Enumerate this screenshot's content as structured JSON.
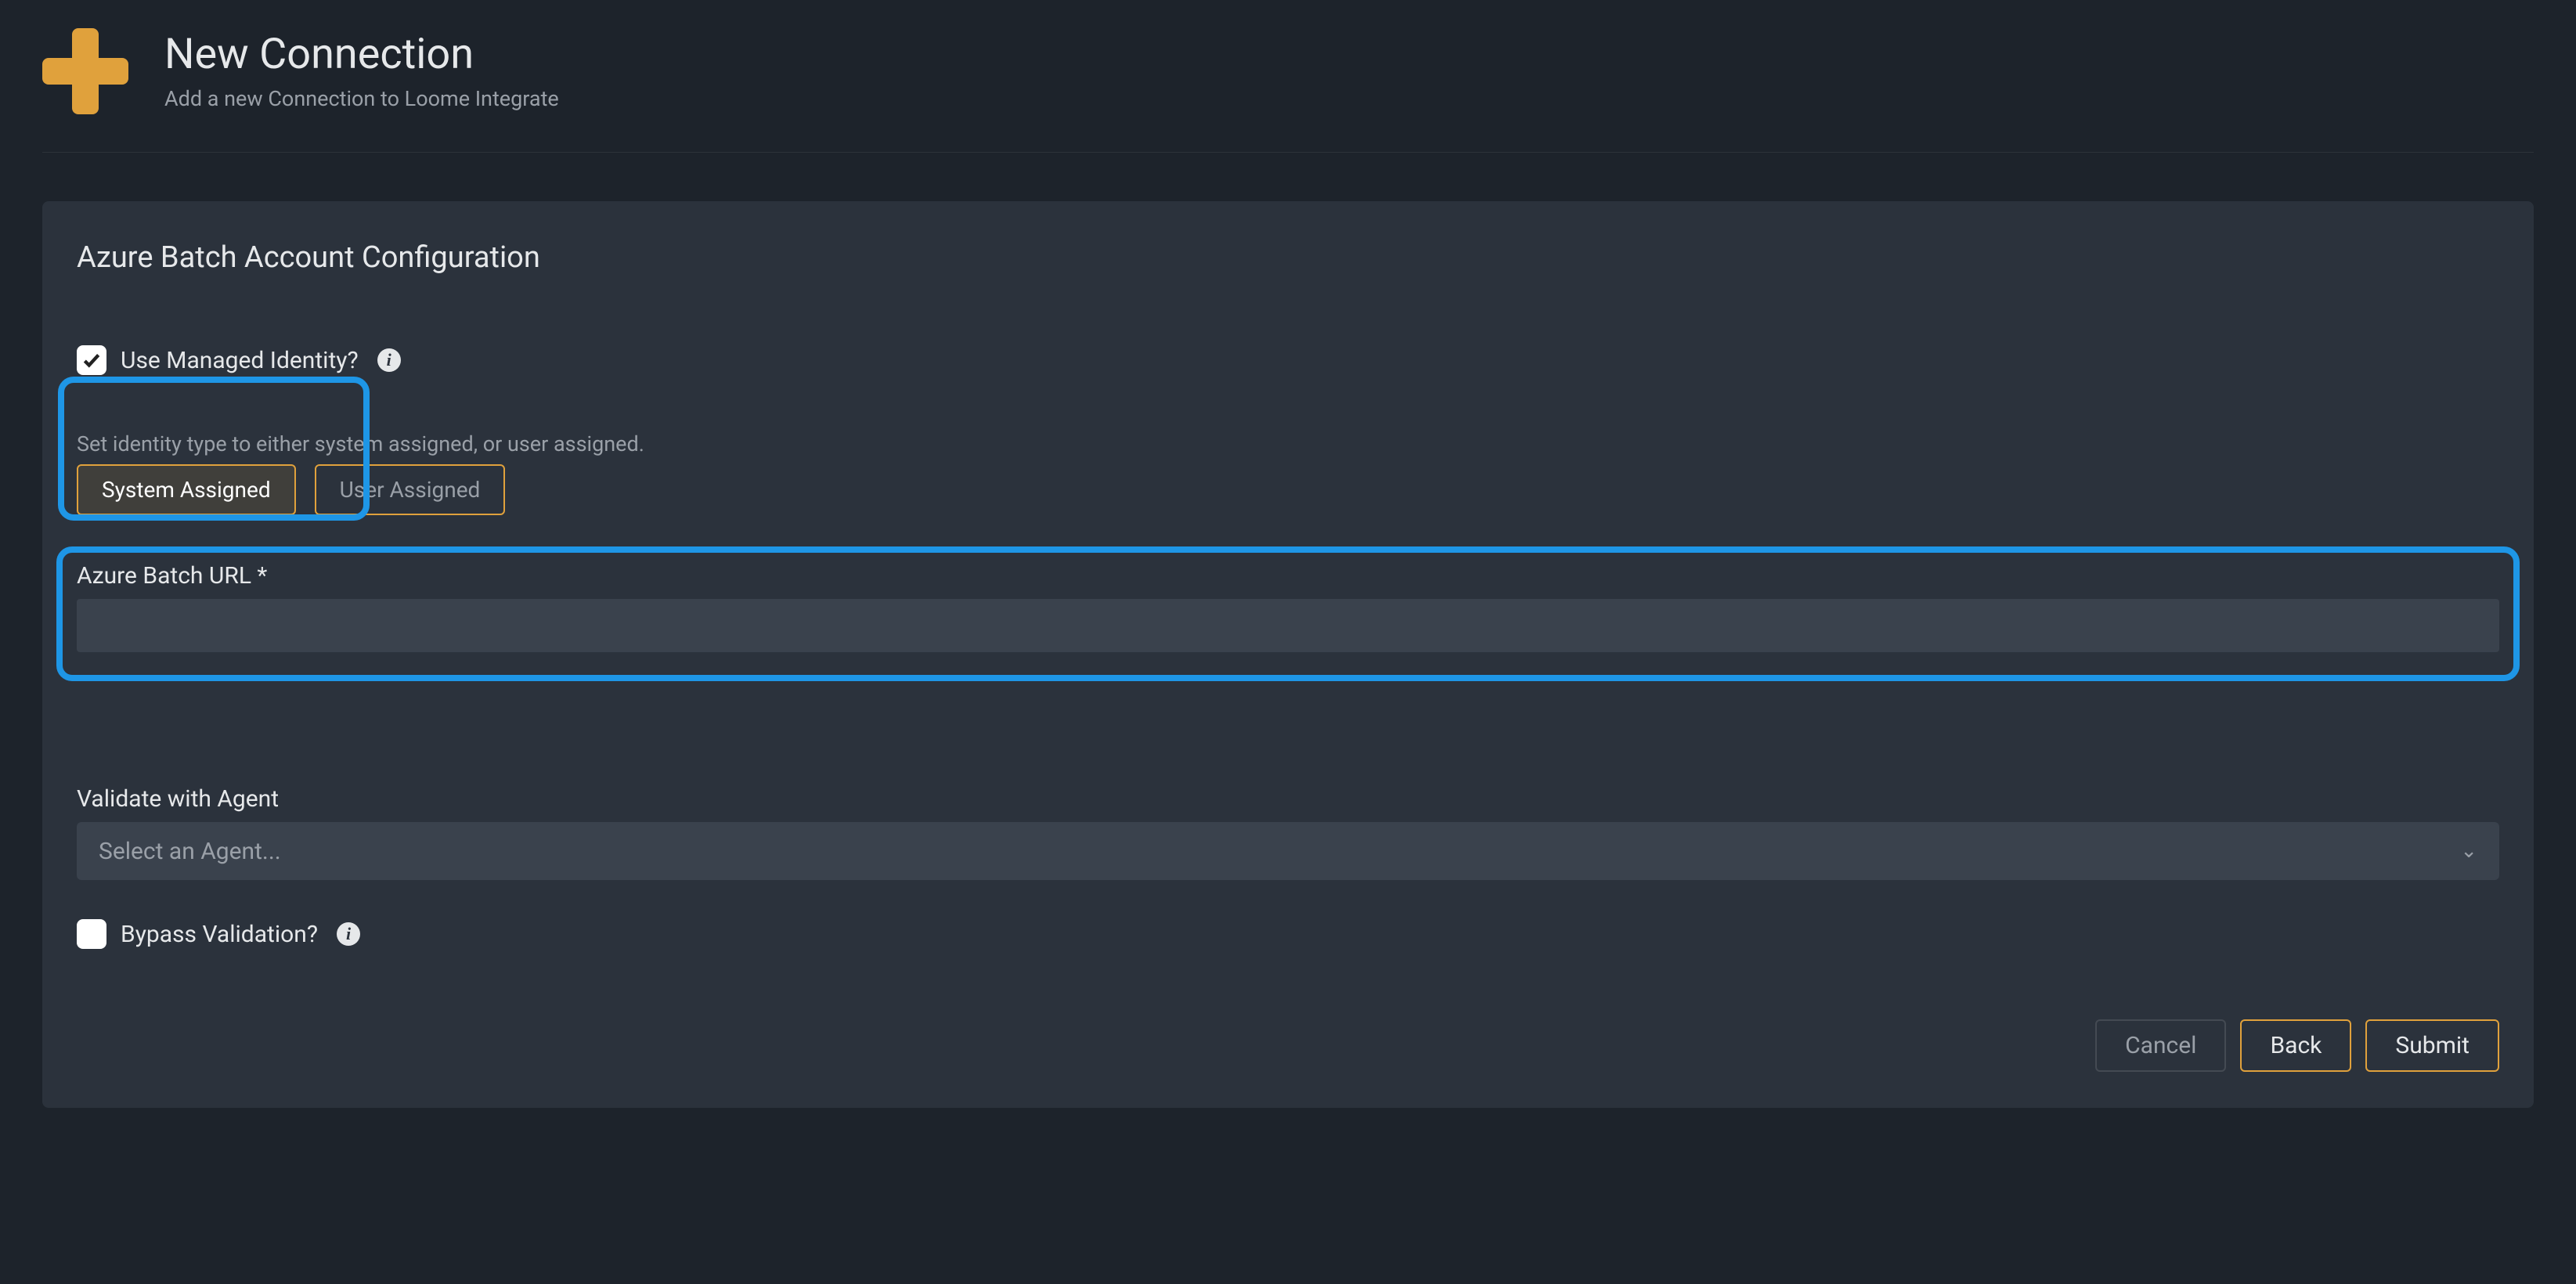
{
  "header": {
    "title": "New Connection",
    "subtitle": "Add a new Connection to Loome Integrate"
  },
  "panel": {
    "title": "Azure Batch Account Configuration",
    "managed_identity": {
      "label": "Use Managed Identity?",
      "checked": true
    },
    "identity_hint": "Set identity type to either system assigned, or user assigned.",
    "identity_options": {
      "system": "System Assigned",
      "user": "User Assigned",
      "selected": "system"
    },
    "batch_url": {
      "label": "Azure Batch URL *",
      "value": ""
    },
    "validate_agent": {
      "label": "Validate with Agent",
      "placeholder": "Select an Agent..."
    },
    "bypass": {
      "label": "Bypass Validation?",
      "checked": false
    },
    "footer": {
      "cancel": "Cancel",
      "back": "Back",
      "submit": "Submit"
    }
  },
  "colors": {
    "accent": "#e0a13c",
    "highlight": "#1e96e6"
  }
}
